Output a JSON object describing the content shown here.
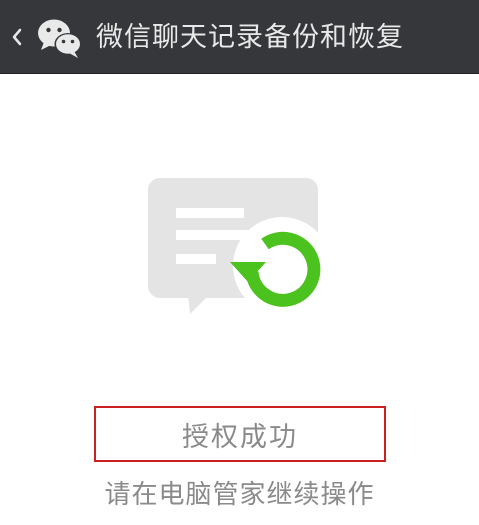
{
  "header": {
    "title": "微信聊天记录备份和恢复",
    "back_icon": "chevron-left-icon",
    "logo_icon": "wechat-logo-icon"
  },
  "hero": {
    "icon": "chat-restore-icon",
    "bubble_color": "#e4e4e4",
    "accent_color": "#4bc21d"
  },
  "status": {
    "text": "授权成功",
    "highlight_color": "#cc2020"
  },
  "hint": {
    "text": "请在电脑管家继续操作"
  }
}
